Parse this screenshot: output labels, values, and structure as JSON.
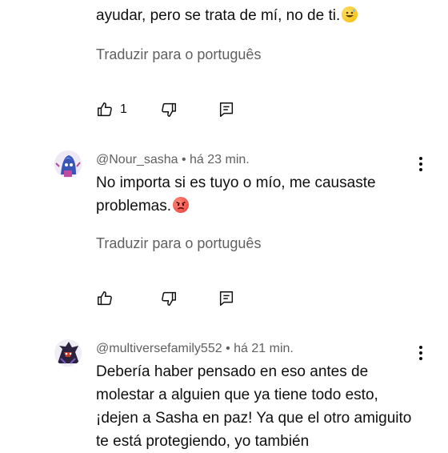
{
  "comments": [
    {
      "text": "ayudar, pero se trata de mí, no de ti.",
      "emoji": "grinning-sweat-emoji",
      "translate_label": "Traduzir para o português",
      "likes": "1"
    },
    {
      "author": "@Nour_sasha",
      "time": "há 23 min.",
      "text": "No importa si es tuyo o mío, me causaste problemas.",
      "emoji": "angry-face-emoji",
      "translate_label": "Traduzir para o português",
      "likes": ""
    },
    {
      "author": "@multiversefamily552",
      "time": "há 21 min.",
      "text": "Debería haber pensado en eso antes de molestar a alguien que ya tiene todo esto, ¡dejen a Sasha en paz! Ya que el otro amiguito te está protegiendo, yo también"
    }
  ],
  "separator": "•",
  "colors": {
    "text": "#0f0f0f",
    "secondary": "#606060",
    "background": "#ffffff"
  },
  "icons": [
    "thumbs-up-icon",
    "thumbs-down-icon",
    "reply-icon",
    "more-vert-icon"
  ]
}
